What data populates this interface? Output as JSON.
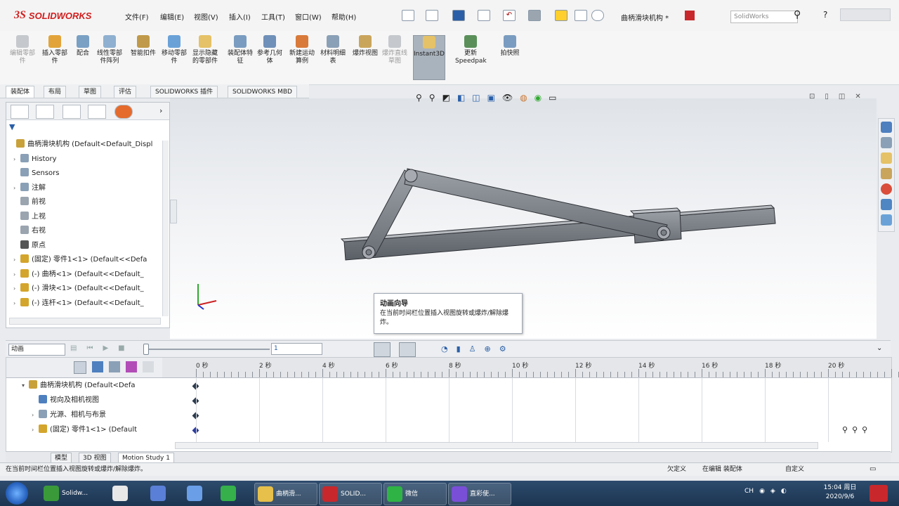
{
  "app": {
    "brand_prefix": "3S",
    "brand": "SOLIDWORKS",
    "document_title": "曲柄滑块机构 *",
    "search_placeholder": "SolidWorks",
    "help_label": "?"
  },
  "menu": [
    "文件(F)",
    "编辑(E)",
    "视图(V)",
    "插入(I)",
    "工具(T)",
    "窗口(W)",
    "帮助(H)"
  ],
  "ribbon": {
    "buttons": [
      {
        "label": "编辑零部件",
        "state": "gray"
      },
      {
        "label": "插入零部件"
      },
      {
        "label": "配合"
      },
      {
        "label": "线性零部件阵列"
      },
      {
        "label": "智能扣件"
      },
      {
        "label": "移动零部件"
      },
      {
        "label": "显示隐藏的零部件"
      },
      {
        "label": "装配体特征"
      },
      {
        "label": "参考几何体"
      },
      {
        "label": "新建运动算例"
      },
      {
        "label": "材料明细表"
      },
      {
        "label": "爆炸视图"
      },
      {
        "label": "爆炸直线草图",
        "state": "gray"
      },
      {
        "label": "Instant3D",
        "state": "active"
      },
      {
        "label": "更新Speedpak"
      },
      {
        "label": "拍快照"
      }
    ]
  },
  "tabs": [
    "装配体",
    "布局",
    "草图",
    "评估",
    "SOLIDWORKS 插件",
    "SOLIDWORKS MBD"
  ],
  "feature_tree": {
    "filter_label": "▼",
    "items": [
      {
        "label": "曲柄滑块机构  (Default<Default_Displ",
        "indent": 0,
        "expand": ""
      },
      {
        "label": "History",
        "indent": 1,
        "expand": "›"
      },
      {
        "label": "Sensors",
        "indent": 1,
        "expand": ""
      },
      {
        "label": "注解",
        "indent": 1,
        "expand": "›"
      },
      {
        "label": "前视",
        "indent": 1,
        "expand": ""
      },
      {
        "label": "上视",
        "indent": 1,
        "expand": ""
      },
      {
        "label": "右视",
        "indent": 1,
        "expand": ""
      },
      {
        "label": "原点",
        "indent": 1,
        "expand": ""
      },
      {
        "label": "(固定) 零件1<1> (Default<<Defa",
        "indent": 1,
        "expand": "›"
      },
      {
        "label": "(-) 曲柄<1> (Default<<Default_",
        "indent": 1,
        "expand": "›"
      },
      {
        "label": "(-) 滑块<1> (Default<<Default_",
        "indent": 1,
        "expand": "›"
      },
      {
        "label": "(-) 连杆<1> (Default<<Default_",
        "indent": 1,
        "expand": "›"
      }
    ]
  },
  "tooltip": {
    "title": "动画向导",
    "body": "在当前时间栏位置插入视图旋转或爆炸/解除爆炸。"
  },
  "motion": {
    "study_type": "动画",
    "time_field": "1"
  },
  "timeline": {
    "ticks": [
      "0 秒",
      "2 秒",
      "4 秒",
      "6 秒",
      "8 秒",
      "10 秒",
      "12 秒",
      "14 秒",
      "16 秒",
      "18 秒",
      "20 秒"
    ],
    "rows": [
      {
        "label": "曲柄滑块机构  (Default<Defa",
        "indent": 0,
        "expand": "▾"
      },
      {
        "label": "视向及相机视图",
        "indent": 1,
        "expand": ""
      },
      {
        "label": "光源、相机与布景",
        "indent": 1,
        "expand": "›"
      },
      {
        "label": "(固定) 零件1<1> (Default",
        "indent": 1,
        "expand": "›"
      }
    ]
  },
  "bottom_tabs": [
    "模型",
    "3D 视图",
    "Motion Study 1"
  ],
  "status": {
    "message": "在当前时间栏位置插入视图旋转或爆炸/解除爆炸。",
    "underdefined": "欠定义",
    "editing": "在编辑 装配体",
    "custom": "自定义"
  },
  "taskbar": {
    "items": [
      {
        "label": "Solidw...",
        "color": "#3a9a3a",
        "open": false
      },
      {
        "label": "",
        "color": "#e8e8e8",
        "open": false
      },
      {
        "label": "",
        "color": "#5a7fd6",
        "open": false
      },
      {
        "label": "",
        "color": "#6a9ee6",
        "open": false
      },
      {
        "label": "",
        "color": "#35b04a",
        "open": false
      },
      {
        "label": "曲柄滑...",
        "color": "#e6c04a",
        "open": true
      },
      {
        "label": "SOLID...",
        "color": "#c8282c",
        "open": true
      },
      {
        "label": "微信",
        "color": "#2fb345",
        "open": true
      },
      {
        "label": "直彩使...",
        "color": "#7a4fd8",
        "open": true
      }
    ],
    "tray_lang": "CH",
    "time": "15:04 周日",
    "date": "2020/9/6"
  }
}
